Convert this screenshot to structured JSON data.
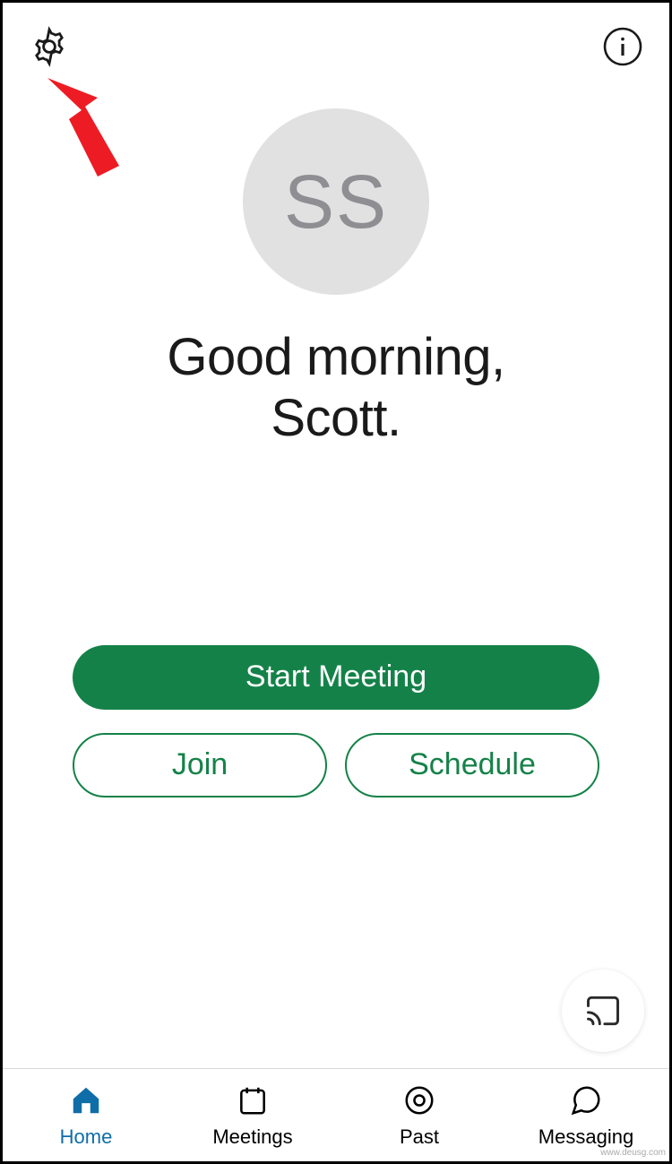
{
  "header": {
    "settings_icon": "gear-icon",
    "info_icon": "info-icon"
  },
  "avatar": {
    "initials": "SS"
  },
  "greeting_line1": "Good morning,",
  "greeting_line2": "Scott.",
  "buttons": {
    "start": "Start Meeting",
    "join": "Join",
    "schedule": "Schedule"
  },
  "fab": {
    "cast_icon": "cast-icon"
  },
  "tabs": [
    {
      "label": "Home",
      "icon": "home-icon",
      "active": true
    },
    {
      "label": "Meetings",
      "icon": "calendar-icon",
      "active": false
    },
    {
      "label": "Past",
      "icon": "record-icon",
      "active": false
    },
    {
      "label": "Messaging",
      "icon": "chat-icon",
      "active": false
    }
  ],
  "colors": {
    "primary_green": "#148248",
    "active_blue": "#0f6ea8",
    "avatar_bg": "#e1e1e1",
    "avatar_text": "#8e8e93"
  },
  "watermark": "www.deusg.com"
}
